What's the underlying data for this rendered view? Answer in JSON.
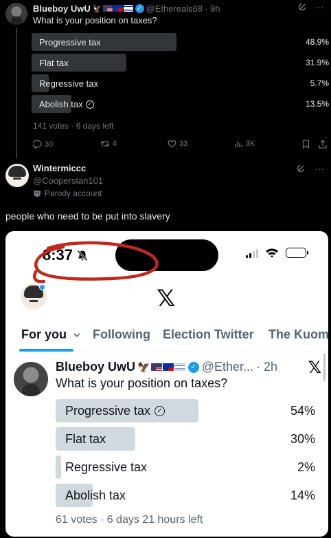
{
  "post": {
    "name": "Blueboy UwU",
    "handle": "@Ethereals68",
    "time": "· 9h",
    "question": "What is your position on taxes?",
    "poll": [
      {
        "label": "Progressive tax",
        "pct": "48.9%",
        "fill": 0.489,
        "check": false
      },
      {
        "label": "Flat tax",
        "pct": "31.9%",
        "fill": 0.319,
        "check": false
      },
      {
        "label": "Regressive tax",
        "pct": "5.7%",
        "fill": 0.057,
        "check": false
      },
      {
        "label": "Abolish tax",
        "pct": "13.5%",
        "fill": 0.135,
        "check": true
      }
    ],
    "meta": "141 votes · 6 days left",
    "replies": "30",
    "reposts": "4",
    "likes": "33",
    "views": "3K"
  },
  "reply": {
    "name": "Wintermiccc",
    "handle": "@Cooperstan101",
    "parody": "Parody account",
    "text": "people who need to be put into slavery"
  },
  "phone": {
    "time": "8:37",
    "tabs": [
      "For you",
      "Following",
      "Election Twitter",
      "The Kuom"
    ],
    "post": {
      "name": "Blueboy UwU",
      "handle": "@Ether...",
      "time": "· 2h",
      "question": "What is your position on taxes?",
      "poll": [
        {
          "label": "Progressive tax",
          "pct": "54%",
          "fill": 0.54,
          "check": true
        },
        {
          "label": "Flat tax",
          "pct": "30%",
          "fill": 0.3,
          "check": false
        },
        {
          "label": "Regressive tax",
          "pct": "2%",
          "fill": 0.02,
          "check": false
        },
        {
          "label": "Abolish tax",
          "pct": "14%",
          "fill": 0.14,
          "check": false
        }
      ],
      "meta": "61 votes · 6 days 21 hours left"
    }
  },
  "colors": {
    "accent": "#1d9bf0",
    "annotation": "#c0281c"
  },
  "icons": [
    "grok-icon",
    "more-icon",
    "reply-icon",
    "repost-icon",
    "like-icon",
    "views-icon",
    "bookmark-icon",
    "share-icon",
    "mask-icon",
    "bell-slash-icon",
    "chevron-down-icon",
    "x-logo-icon"
  ]
}
